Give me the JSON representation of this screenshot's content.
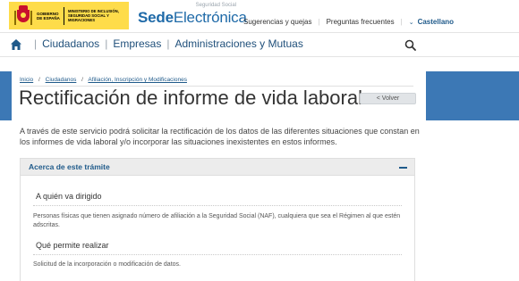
{
  "header": {
    "gov_text": "GOBIERNO DE ESPAÑA",
    "ministry_text": "MINISTERIO DE INCLUSIÓN, SEGURIDAD SOCIAL Y MIGRACIONES",
    "sede_small": "Seguridad Social",
    "sede_bold": "Sede",
    "sede_light": "Electrónica",
    "links": {
      "suggestions": "Sugerencias y quejas",
      "faq": "Preguntas frecuentes",
      "language": "Castellano"
    },
    "icons": {
      "language_chevron": "chevron-down-icon"
    }
  },
  "nav": {
    "items": [
      "Ciudadanos",
      "Empresas",
      "Administraciones y Mutuas"
    ],
    "icons": {
      "home": "home-icon",
      "search": "search-icon"
    }
  },
  "breadcrumb": {
    "items": [
      "Inicio",
      "Ciudadanos",
      "Afiliación, Inscripción y Modificaciones"
    ]
  },
  "page": {
    "title": "Rectificación de informe de vida laboral",
    "back_label": "< Volver",
    "intro": "A través de este servicio podrá solicitar la rectificación de los datos de las diferentes situaciones que constan en los informes de vida laboral y/o incorporar las situaciones inexistentes en estos informes."
  },
  "accordion": {
    "title": "Acerca de este trámite",
    "sections": [
      {
        "title": "A quién va dirigido",
        "text": "Personas físicas que tienen asignado número de afiliación a la Seguridad Social (NAF), cualquiera que sea el Régimen al que estén adscritas."
      },
      {
        "title": "Qué permite realizar",
        "text": "Solicitud de la incorporación o modificación de datos."
      }
    ]
  },
  "colors": {
    "brand_blue": "#1f6aa8",
    "band_blue": "#3c78b5",
    "gov_yellow": "#fedc4a"
  }
}
